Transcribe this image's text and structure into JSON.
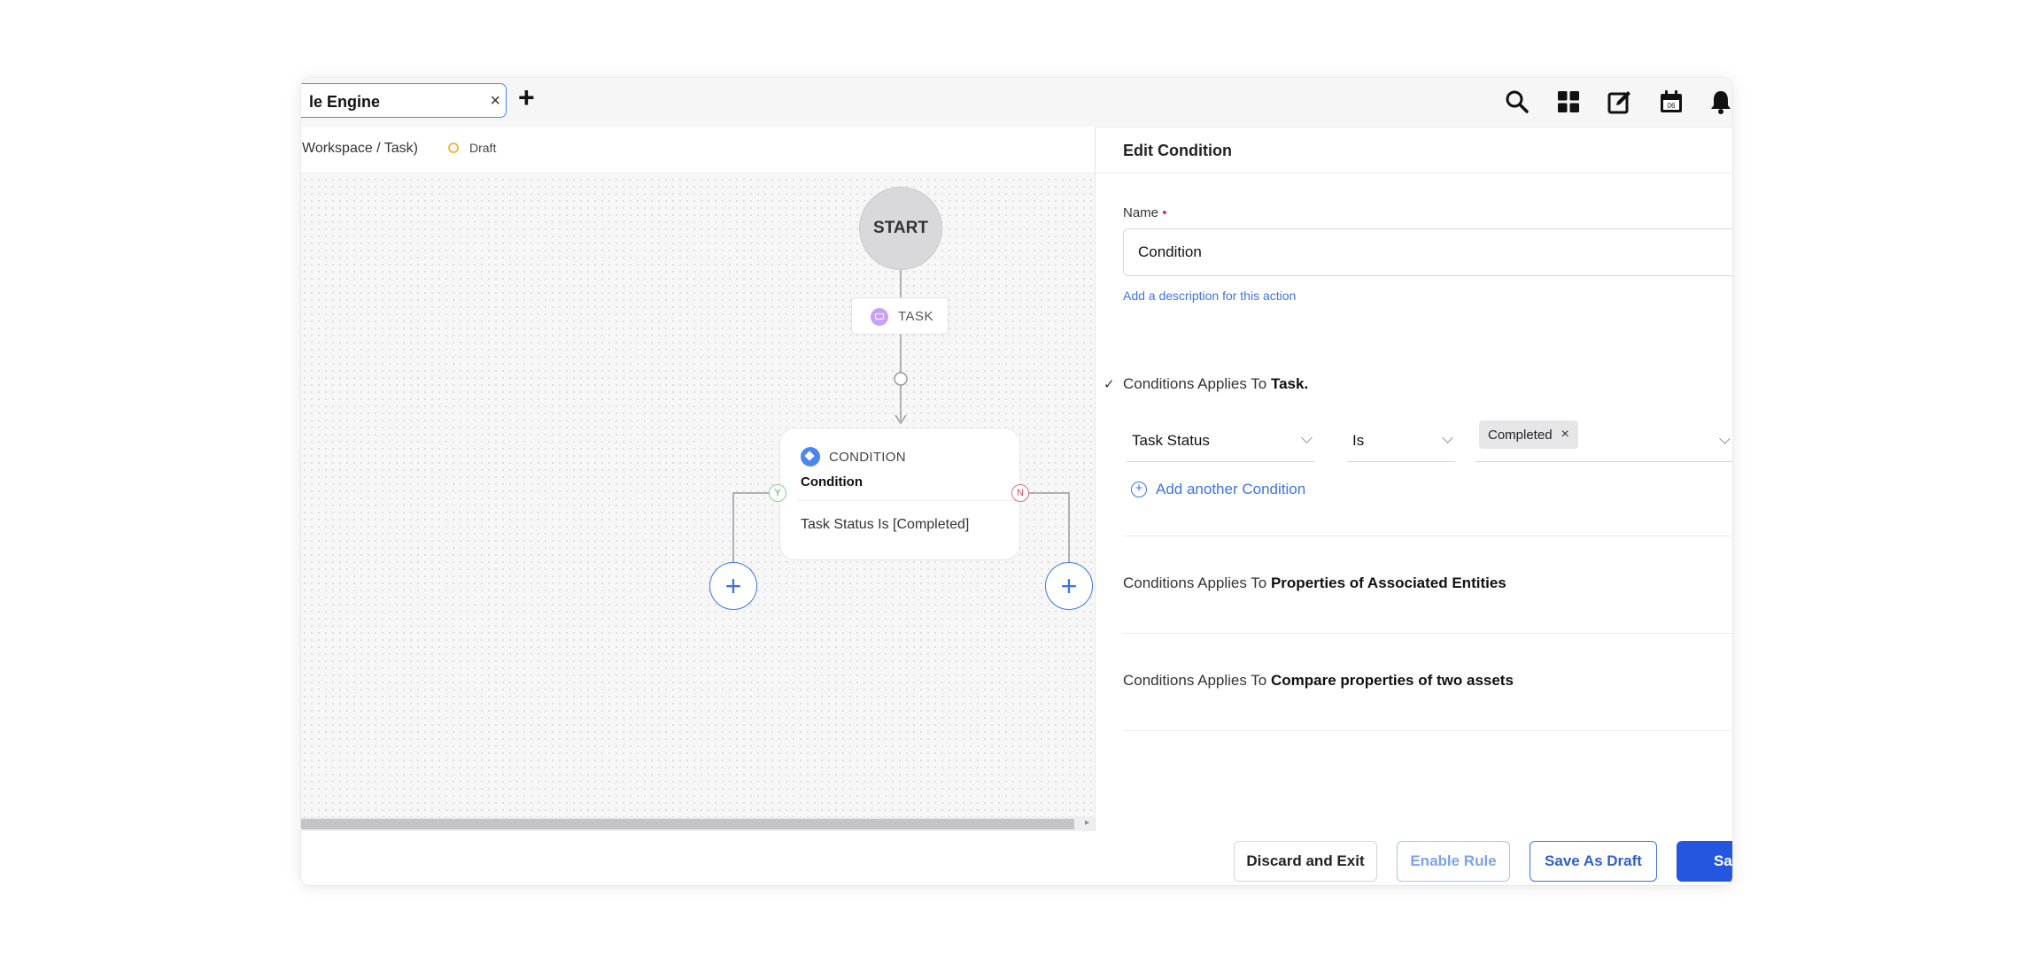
{
  "tabbar": {
    "tab_label": "le Engine",
    "close_glyph": "×",
    "add_glyph": "+"
  },
  "toolbar_icons": [
    "search-icon",
    "grid-icon",
    "edit-icon",
    "calendar-icon",
    "bell-icon"
  ],
  "calendar_day": "06",
  "breadcrumb": {
    "path": "Workspace / Task)",
    "status": "Draft"
  },
  "flow": {
    "start_label": "START",
    "task_label": "TASK",
    "condition_type": "CONDITION",
    "condition_name": "Condition",
    "condition_expr": "Task Status Is [Completed]",
    "yes_label": "Y",
    "no_label": "N",
    "add_glyph": "+"
  },
  "panel": {
    "title": "Edit Condition",
    "name_label": "Name",
    "required_mark": "•",
    "name_value": "Condition",
    "description_link": "Add a description for this action",
    "check_glyph": "✓",
    "section1_prefix": "Conditions Applies To ",
    "section1_bold": "Task.",
    "field_value": "Task Status",
    "operator_value": "Is",
    "chip_value": "Completed",
    "chip_remove": "×",
    "add_condition_glyph": "+",
    "add_condition": "Add another Condition",
    "section2_prefix": "Conditions Applies To ",
    "section2_bold": "Properties of Associated Entities",
    "section3_prefix": "Conditions Applies To ",
    "section3_bold": "Compare properties of two assets"
  },
  "footer": {
    "discard": "Discard and Exit",
    "enable": "Enable Rule",
    "save_draft": "Save As Draft",
    "save": "Sa"
  },
  "colors": {
    "accent": "#3f73e6",
    "primary_button": "#2456e0",
    "draft_status": "#f2b93b",
    "yes_branch": "#56a856",
    "no_branch": "#d34a6e"
  }
}
